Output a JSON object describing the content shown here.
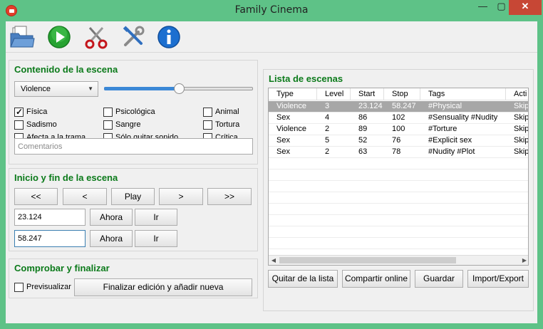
{
  "window": {
    "title": "Family Cinema",
    "min_glyph": "—",
    "max_glyph": "▢",
    "close_glyph": "✕"
  },
  "toolbar": {
    "icons": [
      "folder-open-icon",
      "play-icon",
      "scissors-icon",
      "tools-icon",
      "info-icon"
    ]
  },
  "content_group": {
    "title": "Contenido de la escena",
    "type_select": "Violence",
    "slider_value": 0.5,
    "checkboxes": [
      {
        "label": "Física",
        "checked": true
      },
      {
        "label": "Psicológica",
        "checked": false
      },
      {
        "label": "Animal",
        "checked": false
      },
      {
        "label": "Sadismo",
        "checked": false
      },
      {
        "label": "Sangre",
        "checked": false
      },
      {
        "label": "Tortura",
        "checked": false
      },
      {
        "label": "Afecta a la trama",
        "checked": false
      },
      {
        "label": "Sólo quitar sonido",
        "checked": false
      },
      {
        "label": "Crítica",
        "checked": false
      }
    ],
    "comments_placeholder": "Comentarios"
  },
  "range_group": {
    "title": "Inicio y fin de la escena",
    "nav_buttons": [
      "<<",
      "<",
      "Play",
      ">",
      ">>"
    ],
    "start_value": "23.124",
    "stop_value": "58.247",
    "now_label": "Ahora",
    "go_label": "Ir"
  },
  "finish_group": {
    "title": "Comprobar y finalizar",
    "preview_label": "Previsualizar",
    "preview_checked": false,
    "finish_button": "Finalizar edición y añadir nueva"
  },
  "scene_list": {
    "title": "Lista de escenas",
    "columns": [
      "Type",
      "Level",
      "Start",
      "Stop",
      "Tags",
      "Acti"
    ],
    "rows": [
      {
        "type": "Violence",
        "level": "3",
        "start": "23.124",
        "stop": "58.247",
        "tags": "#Physical",
        "action": "Skip",
        "selected": true
      },
      {
        "type": "Sex",
        "level": "4",
        "start": "86",
        "stop": "102",
        "tags": "#Sensuality #Nudity",
        "action": "Skip",
        "selected": false
      },
      {
        "type": "Violence",
        "level": "2",
        "start": "89",
        "stop": "100",
        "tags": "#Torture",
        "action": "Skip",
        "selected": false
      },
      {
        "type": "Sex",
        "level": "5",
        "start": "52",
        "stop": "76",
        "tags": "#Explicit sex",
        "action": "Skip",
        "selected": false
      },
      {
        "type": "Sex",
        "level": "2",
        "start": "63",
        "stop": "78",
        "tags": "#Nudity #Plot",
        "action": "Skip",
        "selected": false
      }
    ],
    "buttons": [
      "Quitar de la lista",
      "Compartir online",
      "Guardar",
      "Import/Export"
    ]
  }
}
